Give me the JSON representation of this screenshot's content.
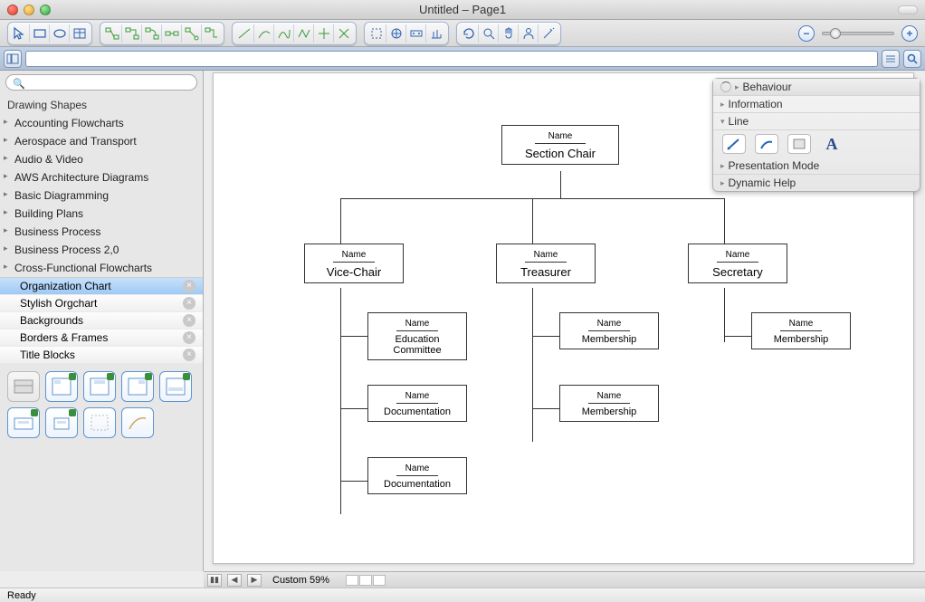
{
  "window": {
    "title": "Untitled – Page1"
  },
  "secondbar": {
    "search_placeholder": ""
  },
  "sidebar": {
    "search_placeholder": "",
    "header": "Drawing Shapes",
    "categories": [
      "Accounting Flowcharts",
      "Aerospace and Transport",
      "Audio & Video",
      "AWS Architecture Diagrams",
      "Basic Diagramming",
      "Building Plans",
      "Business Process",
      "Business Process 2,0",
      "Cross-Functional Flowcharts"
    ],
    "sub_items": [
      "Organization Chart",
      "Stylish Orgchart",
      "Backgrounds",
      "Borders & Frames",
      "Title Blocks"
    ]
  },
  "inspector": {
    "rows": [
      "Behaviour",
      "Information",
      "Line",
      "Presentation Mode",
      "Dynamic Help"
    ]
  },
  "org_chart": {
    "name_label": "Name",
    "level1": {
      "role": "Section Chair"
    },
    "level2": [
      {
        "role": "Vice-Chair"
      },
      {
        "role": "Treasurer"
      },
      {
        "role": "Secretary"
      }
    ],
    "level3_col1": [
      {
        "role": "Education Committee"
      },
      {
        "role": "Documentation"
      },
      {
        "role": "Documentation"
      }
    ],
    "level3_col2": [
      {
        "role": "Membership"
      },
      {
        "role": "Membership"
      }
    ],
    "level3_col3": [
      {
        "role": "Membership"
      }
    ]
  },
  "bottom": {
    "zoom_label": "Custom 59%"
  },
  "status": {
    "text": "Ready"
  }
}
